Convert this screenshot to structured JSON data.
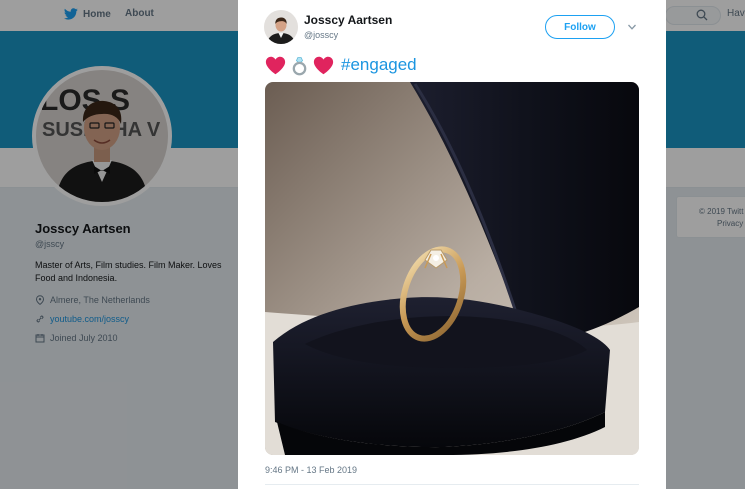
{
  "nav": {
    "home_label": "Home",
    "about_label": "About",
    "right_label": "Hav"
  },
  "profile": {
    "name": "Josscy Aartsen",
    "handle": "@jsscy",
    "bio": "Master of Arts, Film studies. Film Maker. Loves Food and Indonesia.",
    "location": "Almere, The Netherlands",
    "website": "youtube.com/josscy",
    "joined": "Joined July 2010",
    "avatar_banner_text_1": "LOS S",
    "avatar_banner_text_2": "SUSHGHA V"
  },
  "footer": {
    "copyright": "© 2019 Twitt",
    "privacy": "Privacy"
  },
  "tweet": {
    "author_name": "Josscy Aartsen",
    "author_handle": "@josscy",
    "follow_label": "Follow",
    "emojis": [
      "heart-icon",
      "ring-icon",
      "heart-icon"
    ],
    "hashtag": "#engaged",
    "timestamp": "9:46 PM - 13 Feb 2019"
  },
  "colors": {
    "banner": "#1b95c4",
    "accent": "#1da1f2",
    "link": "#1b95e0",
    "heart": "#e0245e"
  }
}
